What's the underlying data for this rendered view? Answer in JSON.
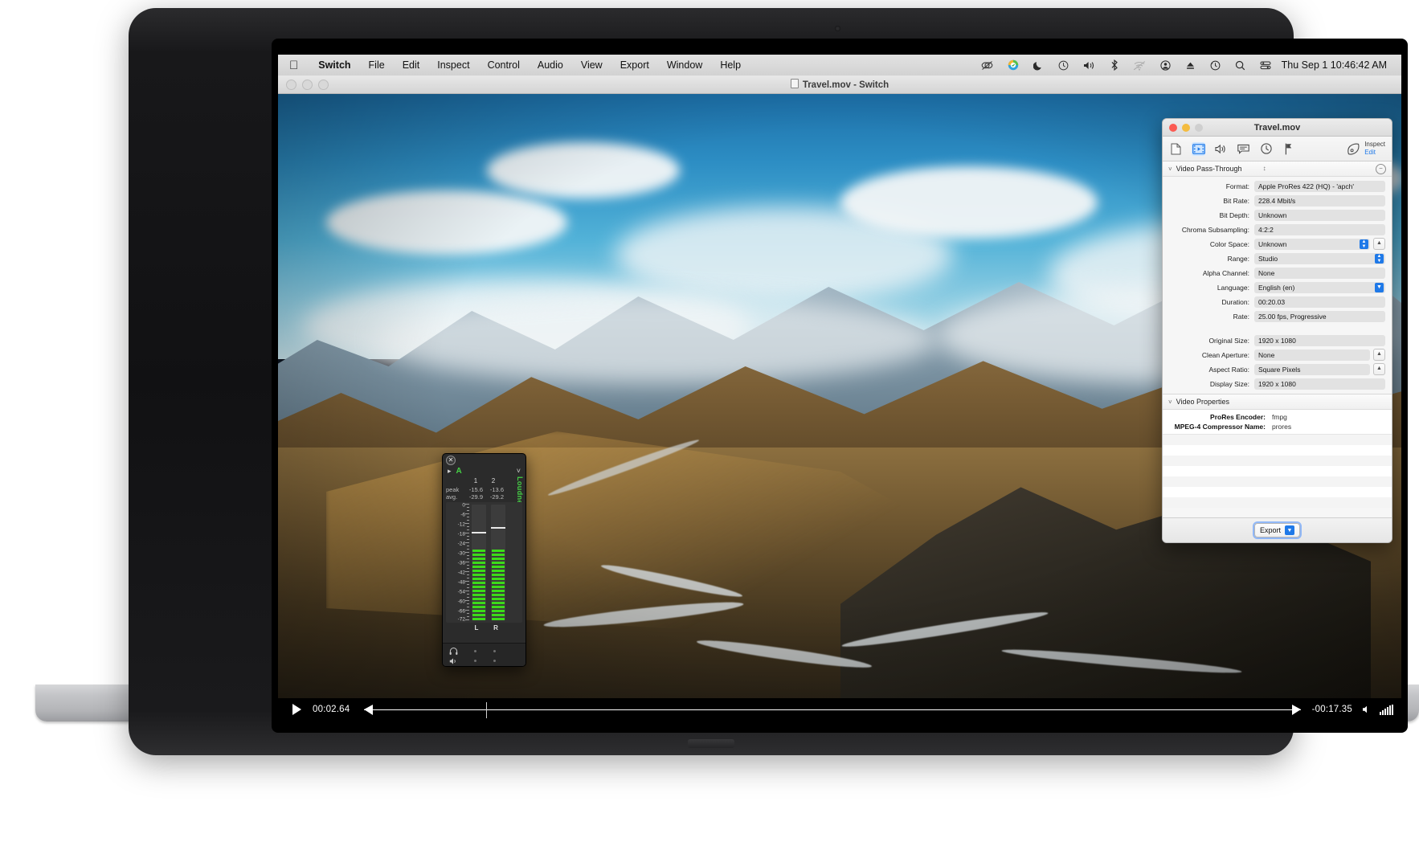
{
  "menubar": {
    "apple_icon": "apple-icon",
    "items": [
      {
        "label": "Switch",
        "bold": true
      },
      {
        "label": "File"
      },
      {
        "label": "Edit"
      },
      {
        "label": "Inspect"
      },
      {
        "label": "Control"
      },
      {
        "label": "Audio"
      },
      {
        "label": "View"
      },
      {
        "label": "Export"
      },
      {
        "label": "Window"
      },
      {
        "label": "Help"
      }
    ],
    "status_icons": [
      "creative-cloud-icon",
      "drive-sync-icon",
      "do-not-disturb-moon-icon",
      "time-machine-icon",
      "volume-icon",
      "bluetooth-icon",
      "wifi-off-icon",
      "user-account-icon",
      "eject-icon",
      "clock-history-icon",
      "spotlight-search-icon",
      "control-center-icon"
    ],
    "clock": "Thu Sep 1  10:46:42 AM"
  },
  "video_window": {
    "title": "Travel.mov - Switch",
    "doc_icon": "document-icon",
    "traffic_lights": [
      "close",
      "minimize",
      "zoom"
    ],
    "transport": {
      "play_icon": "play-icon",
      "current_time": "00:02.64",
      "remaining_time": "-00:17.35",
      "volume_icon": "speaker-icon",
      "progress_percent": 13
    }
  },
  "audio_meter": {
    "close_icon": "close-icon",
    "disclosure_icon": "disclosure-arrow-icon",
    "track_label": "A",
    "collapse_icon": "chevron-down-icon",
    "loudness_label": "Loudness",
    "channel_numbers": [
      "1",
      "2"
    ],
    "stats": [
      {
        "label": "peak",
        "values": [
          "-15.6",
          "-13.6"
        ]
      },
      {
        "label": "avg.",
        "values": [
          "-29.9",
          "-29.2"
        ]
      }
    ],
    "scale_labels": [
      "0",
      "-6",
      "-12",
      "-18",
      "-24",
      "-30",
      "-36",
      "-42",
      "-48",
      "-54",
      "-60",
      "-66",
      "-72"
    ],
    "channel_labels": [
      "L",
      "R"
    ],
    "footer_icons": [
      "headphones-icon",
      "speaker-icon"
    ],
    "meter_color": "#3bdc18",
    "accent_color": "#46d246"
  },
  "inspector": {
    "title": "Travel.mov",
    "traffic_lights": [
      "close",
      "minimize",
      "zoom"
    ],
    "toolbar_icons": [
      {
        "name": "document-icon",
        "selected": false
      },
      {
        "name": "film-video-icon",
        "selected": true
      },
      {
        "name": "audio-speaker-icon",
        "selected": false
      },
      {
        "name": "subtitle-icon",
        "selected": false
      },
      {
        "name": "timecode-clock-icon",
        "selected": false
      },
      {
        "name": "marker-flag-icon",
        "selected": false
      }
    ],
    "mode_icon": "inspect-pointer-icon",
    "mode_inspect": "Inspect",
    "mode_edit": "Edit",
    "section_video": {
      "title": "Video Pass-Through",
      "chevron_icon": "chevron-down-icon",
      "stepper_icon": "up-down-stepper-icon",
      "remove_icon": "minus-circle-icon"
    },
    "fields_primary": [
      {
        "label": "Format:",
        "value": "Apple ProRes 422 (HQ) - 'apch'",
        "control": "none"
      },
      {
        "label": "Bit Rate:",
        "value": "228.4 Mbit/s",
        "control": "none"
      },
      {
        "label": "Bit Depth:",
        "value": "Unknown",
        "control": "none"
      },
      {
        "label": "Chroma Subsampling:",
        "value": "4:2:2",
        "control": "none"
      },
      {
        "label": "Color Space:",
        "value": "Unknown",
        "control": "stepper",
        "side": "up"
      },
      {
        "label": "Range:",
        "value": "Studio",
        "control": "stepper"
      },
      {
        "label": "Alpha Channel:",
        "value": "None",
        "control": "none"
      },
      {
        "label": "Language:",
        "value": "English (en)",
        "control": "popup"
      },
      {
        "label": "Duration:",
        "value": "00:20.03",
        "control": "none"
      },
      {
        "label": "Rate:",
        "value": "25.00 fps, Progressive",
        "control": "none"
      }
    ],
    "fields_size": [
      {
        "label": "Original Size:",
        "value": "1920 x 1080",
        "control": "none"
      },
      {
        "label": "Clean Aperture:",
        "value": "None",
        "control": "none",
        "side": "up"
      },
      {
        "label": "Aspect Ratio:",
        "value": "Square Pixels",
        "control": "none",
        "side": "up"
      },
      {
        "label": "Display Size:",
        "value": "1920 x 1080",
        "control": "none"
      }
    ],
    "section_properties": {
      "title": "Video Properties",
      "chevron_icon": "chevron-down-icon"
    },
    "properties": [
      {
        "key": "ProRes Encoder:",
        "value": "fmpg"
      },
      {
        "key": "MPEG-4 Compressor Name:",
        "value": "prores"
      }
    ],
    "export_button": {
      "label": "Export",
      "chevron_icon": "chevron-down-icon"
    },
    "accent_color": "#1f79e8"
  }
}
